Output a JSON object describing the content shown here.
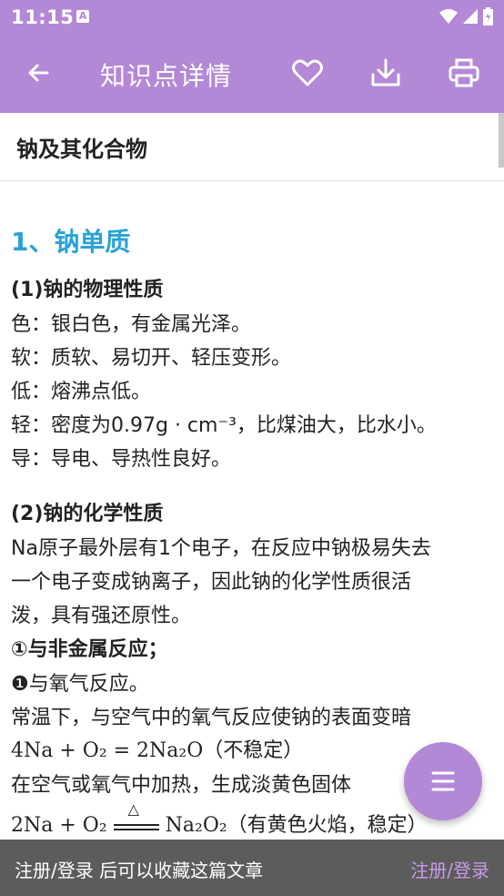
{
  "status": {
    "time": "11:15",
    "indicator": "A"
  },
  "appbar": {
    "title": "知识点详情",
    "icons": [
      "back-arrow-icon",
      "heart-icon",
      "download-icon",
      "print-icon"
    ]
  },
  "document": {
    "title": "钠及其化合物",
    "heading1": "1、钠单质",
    "lines": [
      {
        "text": "(1)钠的物理性质",
        "bold": true
      },
      {
        "text": "色：银白色，有金属光泽。",
        "bold": false
      },
      {
        "text": "软：质软、易切开、轻压变形。",
        "bold": false
      },
      {
        "text": "低：熔沸点低。",
        "bold": false
      },
      {
        "text": "轻：密度为0.97g · cm⁻³，比煤油大，比水小。",
        "bold": false
      },
      {
        "text": "导：导电、导热性良好。",
        "bold": false
      },
      {
        "text": "(2)钠的化学性质",
        "bold": true
      },
      {
        "text": "Na原子最外层有1个电子，在反应中钠极易失去",
        "bold": false
      },
      {
        "text": "一个电子变成钠离子，因此钠的化学性质很活",
        "bold": false
      },
      {
        "text": "泼，具有强还原性。",
        "bold": false
      },
      {
        "text": "①与非金属反应；",
        "bold": true
      },
      {
        "text": "❶与氧气反应。",
        "bold": false
      },
      {
        "text": "常温下，与空气中的氧气反应使钠的表面变暗",
        "bold": false
      },
      {
        "text": "4Na + O₂ = 2Na₂O（不稳定）",
        "bold": false
      },
      {
        "text": "在空气或氧气中加热，生成淡黄色固体",
        "bold": false
      }
    ],
    "eq_left": "2Na + O₂",
    "eq_condition": "△",
    "eq_right": "Na₂O₂（有黄色火焰，稳定）"
  },
  "fab": {
    "icon": "menu-lines-icon"
  },
  "bottom": {
    "message": "注册/登录 后可以收藏这篇文章",
    "link": "注册/登录"
  },
  "colors": {
    "accent": "#b388d6",
    "heading": "#29a3d6",
    "bottom_bg": "#5c5c5c",
    "link": "#c79be8"
  }
}
